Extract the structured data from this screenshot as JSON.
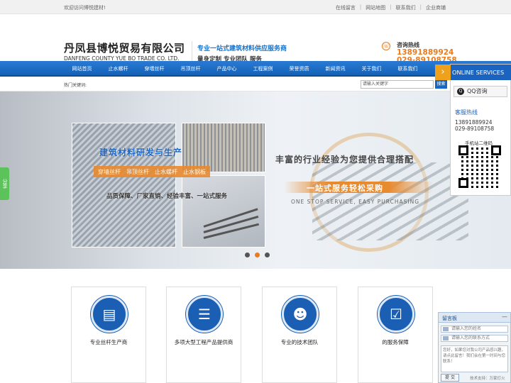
{
  "topbar": {
    "welcome": "欢迎访问博悦建材!",
    "links": [
      "在线留言",
      "网站地图",
      "联系我们",
      "企业商铺"
    ]
  },
  "header": {
    "company_cn": "丹凤县博悦贸易有限公司",
    "company_en": "DANFENG COUNTY YUE BO TRADE CO. LTD.",
    "slogan1": "专业一站式建筑材料供应服务商",
    "slogan2": "量身定制 专业团队 服务",
    "hotline_title": "咨询热线",
    "hotline1": "13891889924",
    "hotline2": "029-89108758"
  },
  "nav": {
    "items": [
      "网站首页",
      "止水螺杆",
      "穿墙丝杆",
      "吊顶丝杆",
      "产品中心",
      "工程案例",
      "荣誉资质",
      "新闻资讯",
      "关于我们",
      "联系我们"
    ]
  },
  "searchbar": {
    "hot_keywords": "热门关键词:",
    "placeholder": "请输入关键字",
    "button": "搜索"
  },
  "banner": {
    "heading": "建筑材料研发与生产",
    "tags": [
      "穿墙丝杆",
      "吊顶丝杆",
      "止水螺杆",
      "止水钢板"
    ],
    "sub": "品质保障、厂家直销、经验丰富、一站式服务",
    "right1": "丰富的行业经验为您提供合理搭配",
    "right2": "一站式服务轻松采购",
    "right3": "ONE STOP SERVICE, EASY PURCHASING",
    "active_dot": 1
  },
  "share": {
    "label": "分享"
  },
  "features": [
    {
      "label": "专业丝杆生产商",
      "icon": "chart-icon"
    },
    {
      "label": "多项大型工程产品提供商",
      "icon": "list-icon"
    },
    {
      "label": "专业的技术团队",
      "icon": "team-icon"
    },
    {
      "label": "的服务保障",
      "icon": "check-icon"
    }
  ],
  "online": {
    "title": "ONLINE SERVICES",
    "qq": "QQ咨询",
    "hotline_title": "客服热线",
    "phone1": "13891889924",
    "phone2": "029-89108758",
    "qr_title": "手机站二维码"
  },
  "message_box": {
    "title": "留言板",
    "min": "—",
    "name_placeholder": "请输入您的姓名",
    "contact_placeholder": "请输入您的联系方式",
    "content_placeholder": "您好，如果您对我公司产品感兴趣，请点此留言！我们会在第一时间与您联系！",
    "submit": "提 交",
    "footer": "技术支持：万家灯火"
  }
}
